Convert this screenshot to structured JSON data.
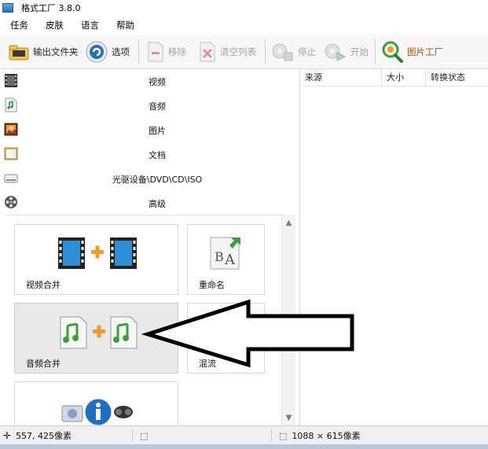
{
  "window": {
    "title": "格式工厂 3.8.0"
  },
  "menu": {
    "items": [
      "任务",
      "皮肤",
      "语言",
      "帮助"
    ]
  },
  "toolbar": {
    "output_folder": "输出文件夹",
    "options": "选项",
    "remove": "移除",
    "clear_list": "清空列表",
    "stop": "停止",
    "start": "开始",
    "picture_factory": "图片工厂"
  },
  "categories": [
    {
      "label": "视频",
      "icon": "video-film-icon"
    },
    {
      "label": "音频",
      "icon": "music-note-icon"
    },
    {
      "label": "图片",
      "icon": "picture-icon"
    },
    {
      "label": "文档",
      "icon": "document-icon"
    },
    {
      "label": "光驱设备\\DVD\\CD\\ISO",
      "icon": "disc-drive-icon"
    },
    {
      "label": "高级",
      "icon": "film-reel-icon"
    }
  ],
  "tools": [
    {
      "label": "视频合并",
      "icon": "video-merge-icon",
      "selected": false
    },
    {
      "label": "重命名",
      "icon": "rename-icon",
      "selected": false
    },
    {
      "label": "音频合并",
      "icon": "audio-merge-icon",
      "selected": true
    },
    {
      "label": "混流",
      "icon": "mux-icon",
      "selected": false
    },
    {
      "label": "",
      "icon": "media-info-icon",
      "selected": false
    }
  ],
  "file_table": {
    "columns": [
      "来源",
      "大小",
      "转换状态"
    ]
  },
  "statusbar": {
    "cursor_pos": "557, 425像素",
    "image_size": "1088 × 615像素"
  },
  "colors": {
    "accent_blue": "#2b6fb5",
    "green": "#3aa13a",
    "plus_orange": "#f29a2e"
  }
}
